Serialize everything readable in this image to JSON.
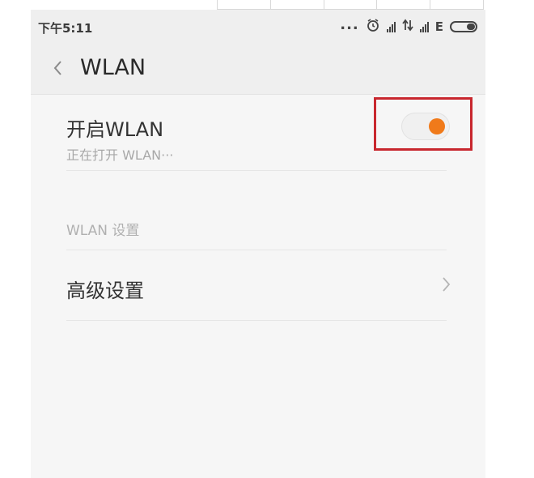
{
  "status_bar": {
    "time": "下午5:11",
    "dots": "...",
    "network_label": "E",
    "icons": [
      "alarm-icon",
      "signal-icon",
      "data-transfer-icon",
      "signal-icon",
      "battery-icon"
    ]
  },
  "header": {
    "title": "WLAN",
    "back_icon": "chevron-left-icon"
  },
  "wlan_toggle_row": {
    "label": "开启WLAN",
    "status": "正在打开 WLAN···",
    "toggle_on": true,
    "toggle_color": "#f07a1a",
    "highlight_color": "#c8272e"
  },
  "section": {
    "header": "WLAN 设置"
  },
  "advanced_row": {
    "label": "高级设置",
    "icon": "chevron-right-icon"
  }
}
